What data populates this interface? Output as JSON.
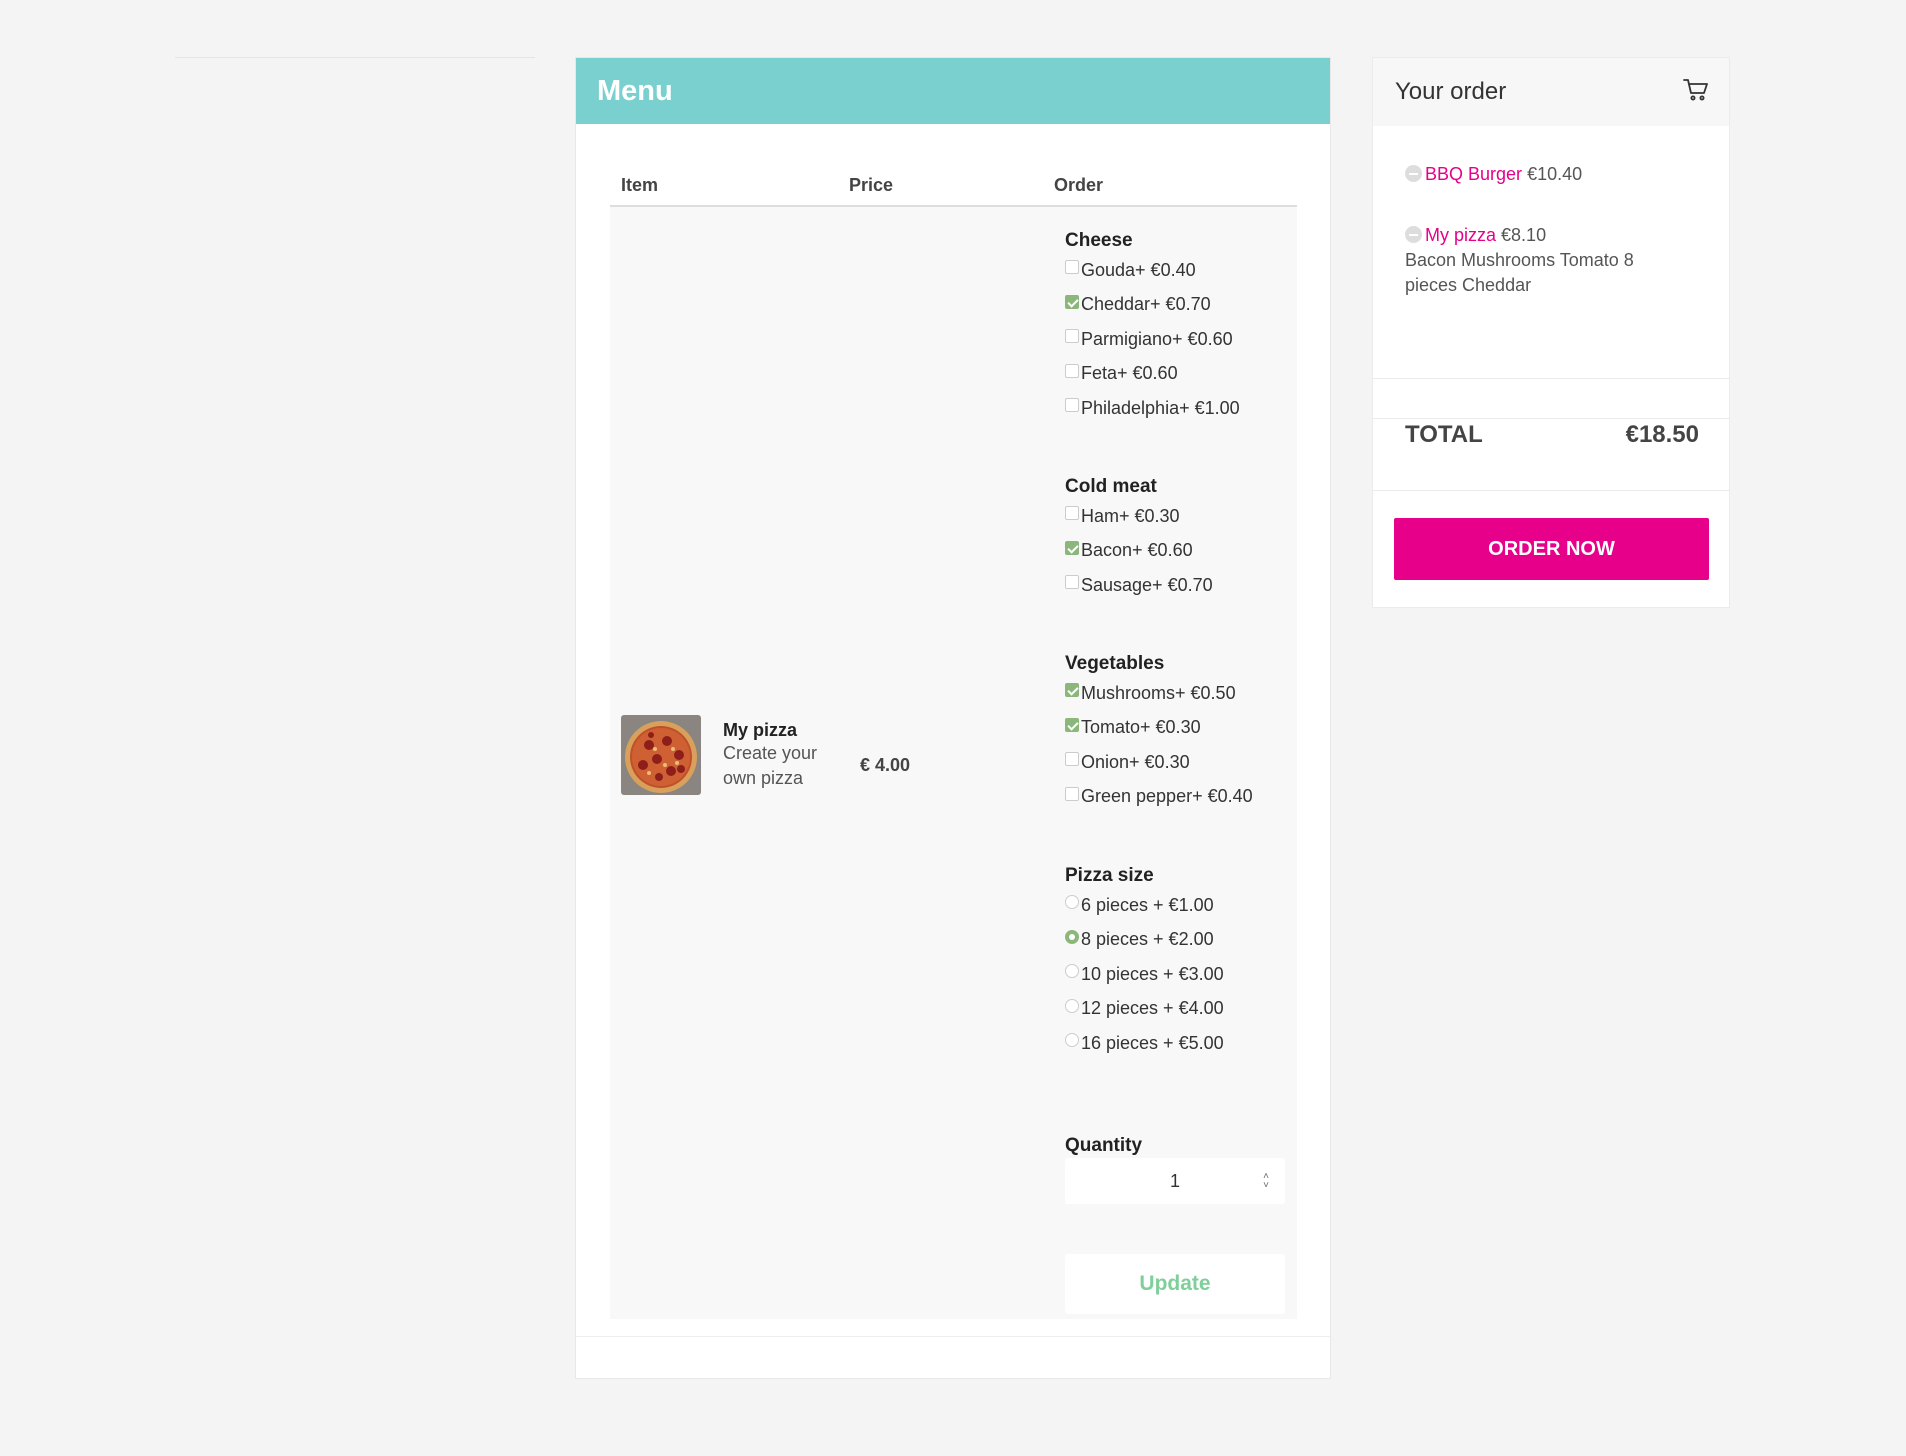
{
  "menu": {
    "title": "Menu",
    "columns": {
      "item": "Item",
      "price": "Price",
      "order": "Order"
    },
    "item": {
      "name": "My pizza",
      "description": "Create your own pizza",
      "price": "€ 4.00"
    },
    "groups": [
      {
        "title": "Cheese",
        "type": "checkbox",
        "options": [
          {
            "label": "Gouda+ €0.40",
            "checked": false
          },
          {
            "label": "Cheddar+ €0.70",
            "checked": true
          },
          {
            "label": "Parmigiano+ €0.60",
            "checked": false
          },
          {
            "label": "Feta+ €0.60",
            "checked": false
          },
          {
            "label": "Philadelphia+ €1.00",
            "checked": false
          }
        ]
      },
      {
        "title": "Cold meat",
        "type": "checkbox",
        "options": [
          {
            "label": "Ham+ €0.30",
            "checked": false
          },
          {
            "label": "Bacon+ €0.60",
            "checked": true
          },
          {
            "label": "Sausage+ €0.70",
            "checked": false
          }
        ]
      },
      {
        "title": "Vegetables",
        "type": "checkbox",
        "options": [
          {
            "label": "Mushrooms+ €0.50",
            "checked": true
          },
          {
            "label": "Tomato+ €0.30",
            "checked": true
          },
          {
            "label": "Onion+ €0.30",
            "checked": false
          },
          {
            "label": "Green pepper+ €0.40",
            "checked": false
          }
        ]
      },
      {
        "title": "Pizza size",
        "type": "radio",
        "options": [
          {
            "label": "6 pieces + €1.00",
            "checked": false
          },
          {
            "label": "8 pieces + €2.00",
            "checked": true
          },
          {
            "label": "10 pieces + €3.00",
            "checked": false
          },
          {
            "label": "12 pieces + €4.00",
            "checked": false
          },
          {
            "label": "16 pieces + €5.00",
            "checked": false
          }
        ]
      }
    ],
    "quantity_label": "Quantity",
    "quantity_value": "1",
    "update_label": "Update"
  },
  "order": {
    "title": "Your order",
    "items": [
      {
        "name": "BBQ Burger",
        "price": "€10.40",
        "details": ""
      },
      {
        "name": "My pizza",
        "price": "€8.10",
        "details": "Bacon Mushrooms Tomato 8 pieces Cheddar"
      }
    ],
    "total_label": "TOTAL",
    "total_value": "€18.50",
    "order_button": "ORDER NOW"
  },
  "colors": {
    "header": "#79d0cf",
    "accent": "#e6008a",
    "checked": "#8bb87a",
    "update_text": "#7fcf9a"
  },
  "icons": {
    "cart": "cart-icon",
    "remove": "minus-circle-icon"
  }
}
